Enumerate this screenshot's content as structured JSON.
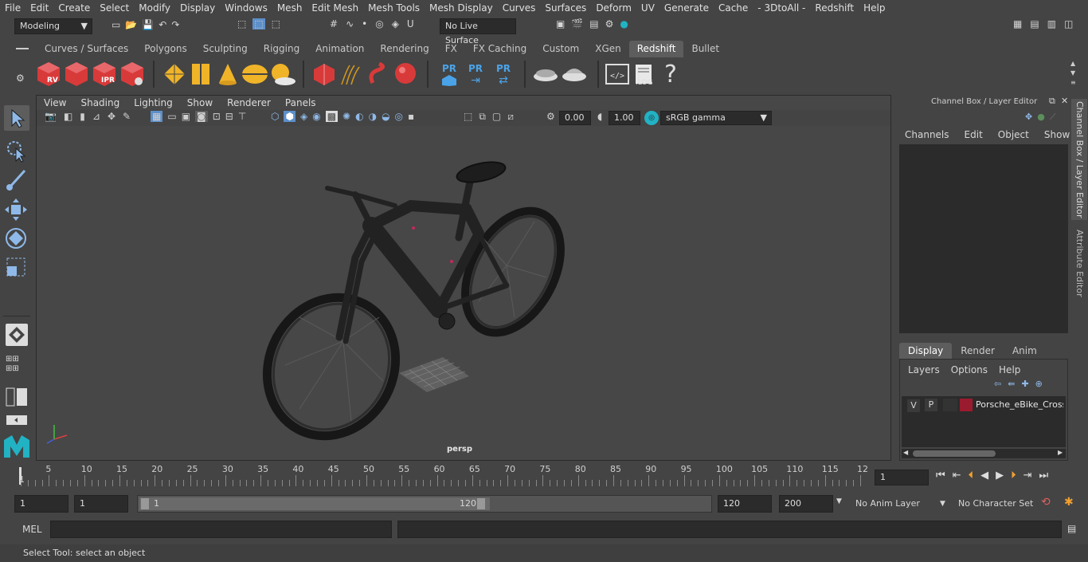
{
  "menu": [
    "File",
    "Edit",
    "Create",
    "Select",
    "Modify",
    "Display",
    "Windows",
    "Mesh",
    "Edit Mesh",
    "Mesh Tools",
    "Mesh Display",
    "Curves",
    "Surfaces",
    "Deform",
    "UV",
    "Generate",
    "Cache",
    "- 3DtoAll -",
    "Redshift",
    "Help"
  ],
  "mode_select": "Modeling",
  "live_surface": "No Live Surface",
  "shelf_tabs": [
    "Curves / Surfaces",
    "Polygons",
    "Sculpting",
    "Rigging",
    "Animation",
    "Rendering",
    "FX",
    "FX Caching",
    "Custom",
    "XGen",
    "Redshift",
    "Bullet"
  ],
  "active_shelf_tab": "Redshift",
  "shelf_labels": {
    "rv": "RV",
    "ipr": "IPR",
    "pr1": "PR",
    "pr2": "PR",
    "pr3": "PR",
    "log": ".LOG",
    "help": "?"
  },
  "viewport": {
    "menu": [
      "View",
      "Shading",
      "Lighting",
      "Show",
      "Renderer",
      "Panels"
    ],
    "exposure": "0.00",
    "gamma": "1.00",
    "color_space": "sRGB gamma",
    "camera_label": "persp"
  },
  "right_panel": {
    "title": "Channel Box / Layer Editor",
    "channel_menu": [
      "Channels",
      "Edit",
      "Object",
      "Show"
    ],
    "layer_tabs": [
      "Display",
      "Render",
      "Anim"
    ],
    "active_layer_tab": "Display",
    "layer_menu": [
      "Layers",
      "Options",
      "Help"
    ],
    "layer": {
      "v": "V",
      "p": "P",
      "name": "Porsche_eBike_Cross_E",
      "color": "#9b1b2e"
    },
    "side_tabs": [
      "Channel Box / Layer Editor",
      "Attribute Editor"
    ]
  },
  "timeline": {
    "ticks": [
      "1",
      "5",
      "10",
      "15",
      "20",
      "25",
      "30",
      "35",
      "40",
      "45",
      "50",
      "55",
      "60",
      "65",
      "70",
      "75",
      "80",
      "85",
      "90",
      "95",
      "100",
      "105",
      "110",
      "115",
      "12"
    ],
    "current_frame": "1"
  },
  "range": {
    "start": "1",
    "playback_start": "1",
    "slider_start": "1",
    "slider_end": "120",
    "playback_end": "120",
    "end": "200",
    "anim_layer": "No Anim Layer",
    "char_set": "No Character Set"
  },
  "command": {
    "lang": "MEL"
  },
  "help_line": "Select Tool: select an object",
  "colors": {
    "accent": "#5d8fc9",
    "redshift": "#d83a3a",
    "teal": "#21b2c4"
  }
}
